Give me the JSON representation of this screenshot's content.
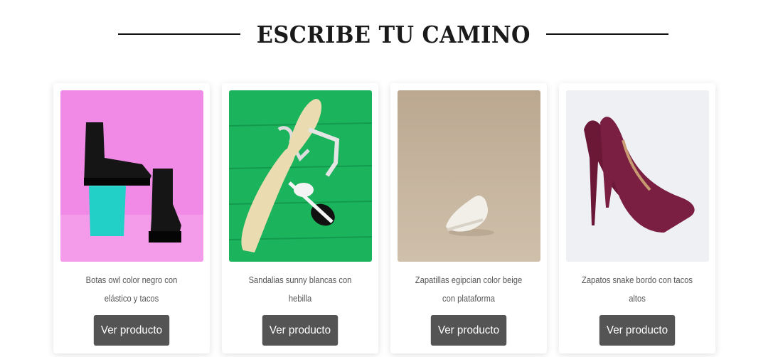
{
  "section": {
    "title": "ESCRIBE TU CAMINO"
  },
  "products": [
    {
      "description": "Botas owl color negro con elástico y tacos",
      "button_label": "Ver producto",
      "image": "black-platform-boots-photo"
    },
    {
      "description": "Sandalias sunny blancas con hebilla",
      "button_label": "Ver producto",
      "image": "white-sandals-sunglasses-photo"
    },
    {
      "description": "Zapatillas egipcian color beige con plataforma",
      "button_label": "Ver producto",
      "image": "beige-sneaker-photo"
    },
    {
      "description": "Zapatos snake bordo con tacos altos",
      "button_label": "Ver producto",
      "image": "burgundy-snake-heels-photo"
    }
  ],
  "colors": {
    "button_bg": "#555454",
    "button_text": "#ffffff",
    "text": "#555555"
  }
}
